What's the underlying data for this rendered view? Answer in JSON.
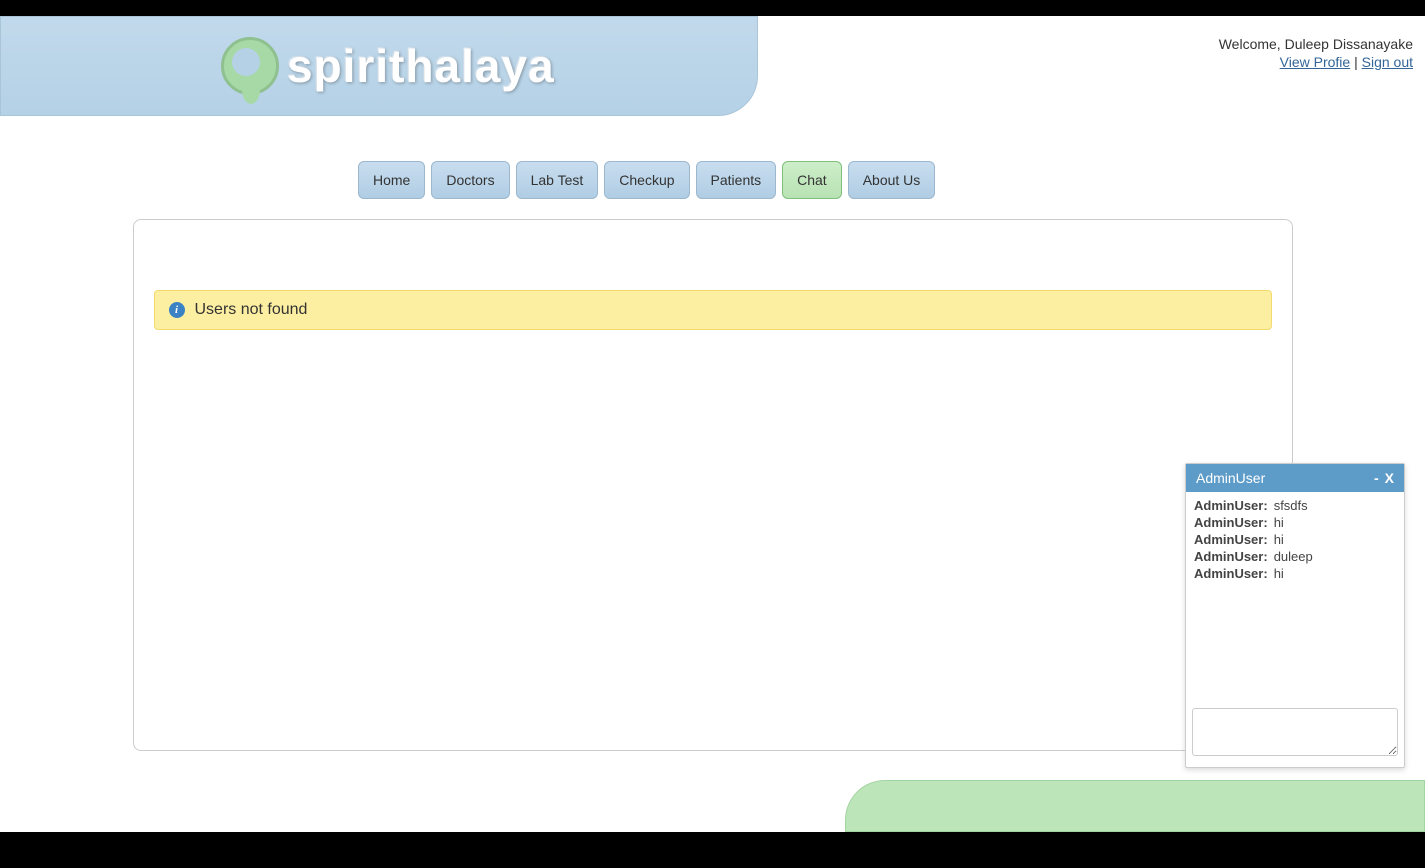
{
  "brand": {
    "name": "spirithalaya"
  },
  "user": {
    "welcomePrefix": "Welcome, ",
    "name": "Duleep Dissanayake",
    "viewProfile": "View Profie",
    "separator": " | ",
    "signOut": "Sign out"
  },
  "nav": {
    "home": "Home",
    "doctors": "Doctors",
    "labTest": "Lab Test",
    "checkup": "Checkup",
    "patients": "Patients",
    "chat": "Chat",
    "aboutUs": "About Us"
  },
  "alert": {
    "iconChar": "i",
    "message": "Users not found"
  },
  "chat": {
    "title": "AdminUser",
    "minimize": "-",
    "close": "X",
    "messages": [
      {
        "sender": "AdminUser:",
        "text": "sfsdfs"
      },
      {
        "sender": "AdminUser:",
        "text": "hi"
      },
      {
        "sender": "AdminUser:",
        "text": "hi"
      },
      {
        "sender": "AdminUser:",
        "text": "duleep"
      },
      {
        "sender": "AdminUser:",
        "text": "hi"
      }
    ]
  }
}
